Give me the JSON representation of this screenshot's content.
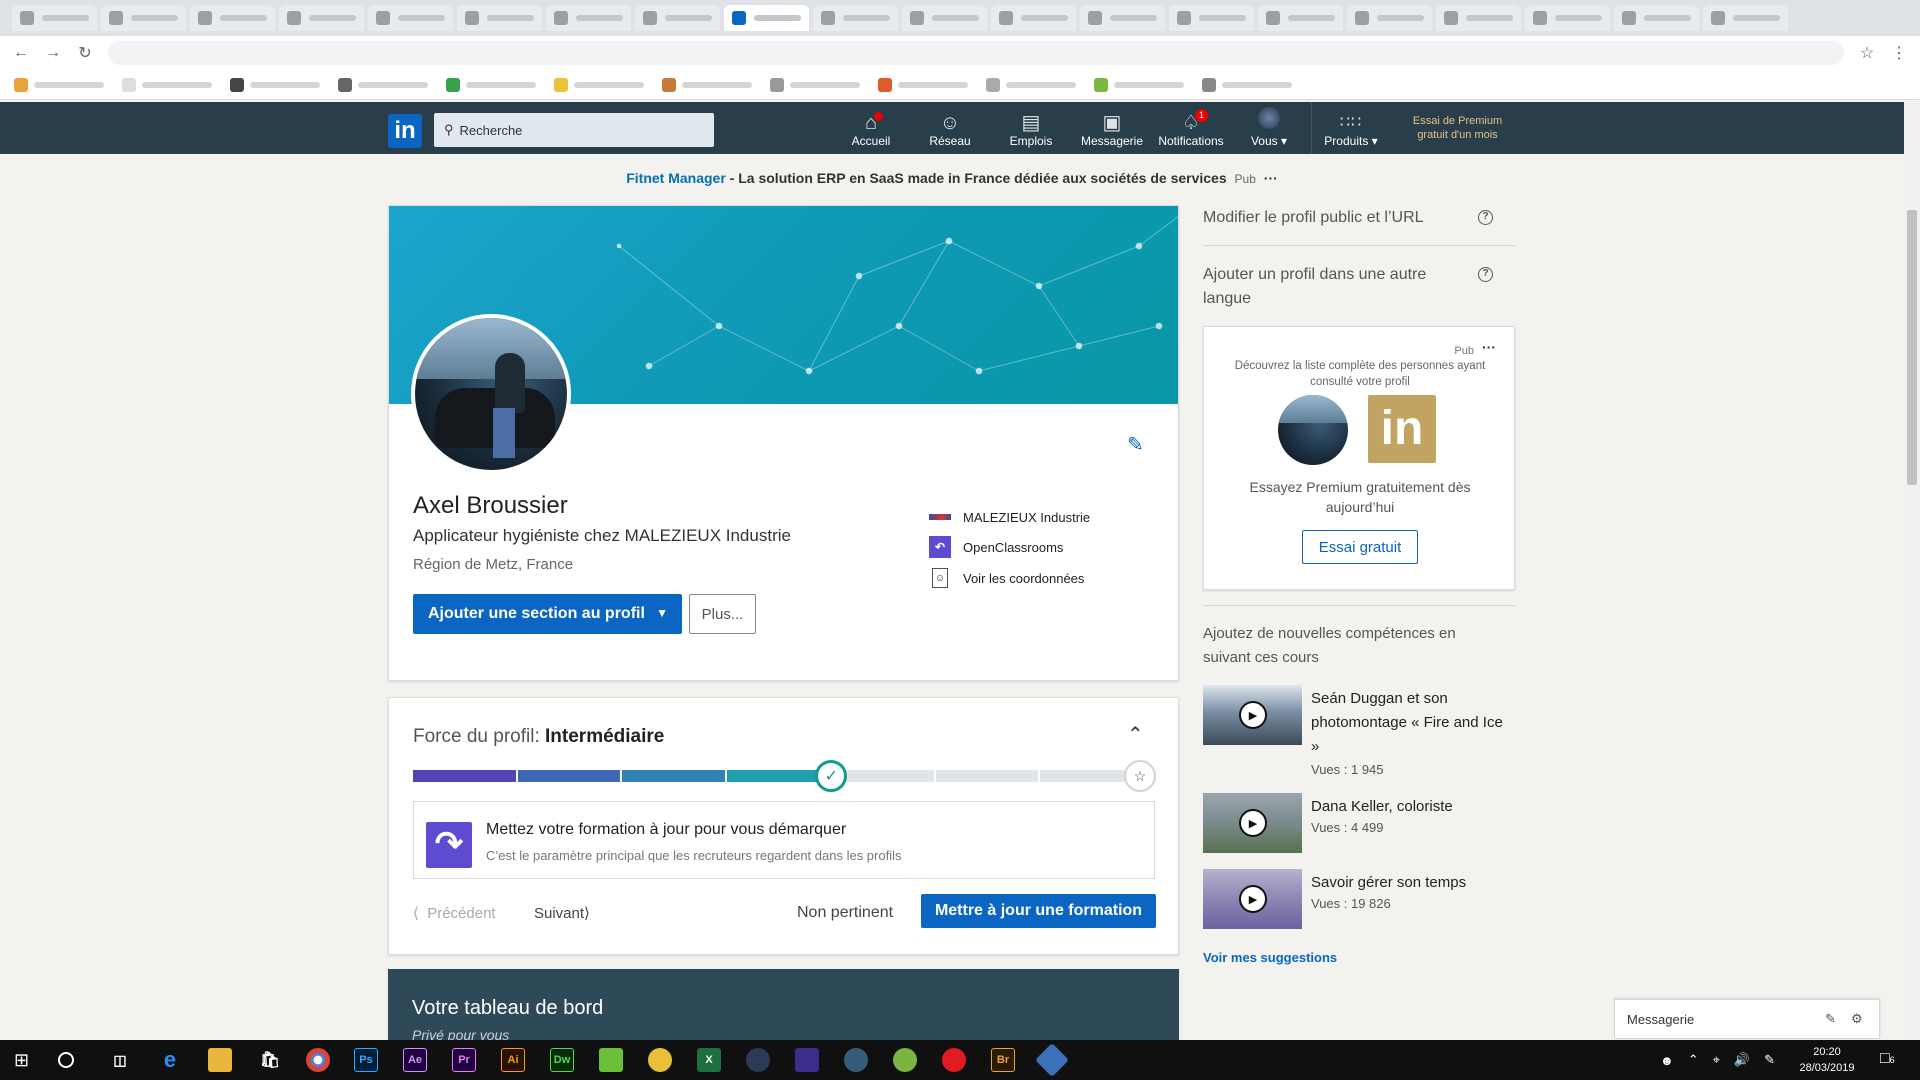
{
  "header": {
    "logo": "in",
    "search_placeholder": "Recherche",
    "nav": [
      {
        "label": "Accueil",
        "icon": "home-icon",
        "badge": ""
      },
      {
        "label": "Réseau",
        "icon": "network-icon",
        "badge": ""
      },
      {
        "label": "Emplois",
        "icon": "jobs-icon",
        "badge": ""
      },
      {
        "label": "Messagerie",
        "icon": "messaging-icon",
        "badge": ""
      },
      {
        "label": "Notifications",
        "icon": "bell-icon",
        "badge": "1"
      },
      {
        "label": "Vous",
        "icon": "avatar-icon",
        "badge": ""
      },
      {
        "label": "Produits",
        "icon": "grid-icon",
        "badge": ""
      }
    ],
    "premium_line1": "Essai de Premium",
    "premium_line2": "gratuit d'un mois"
  },
  "ad": {
    "brand": "Fitnet Manager",
    "text": " - La solution ERP en SaaS made in France dédiée aux sociétés de services",
    "pub": "Pub",
    "dots": "···"
  },
  "profile": {
    "name": "Axel Broussier",
    "headline": "Applicateur hygiéniste chez MALEZIEUX Industrie",
    "location": "Région de Metz, France",
    "add_section_label": "Ajouter une section au profil",
    "more_label": "Plus...",
    "company": "MALEZIEUX Industrie",
    "school": "OpenClassrooms",
    "contact": "Voir les coordonnées"
  },
  "strength": {
    "label": "Force du profil:",
    "level": "Intermédiaire",
    "level_fraction": 0.57,
    "tip_title": "Mettez votre formation à jour pour vous démarquer",
    "tip_sub": "C’est le paramètre principal que les recruteurs regardent dans les profils",
    "prev": "Précédent",
    "next": "Suivant",
    "ignore": "Non pertinent",
    "action": "Mettre à jour une formation"
  },
  "dashboard": {
    "title": "Votre tableau de bord",
    "subtitle": "Privé pour vous"
  },
  "sidebar": {
    "edit_public": "Modifier le profil public et l’URL",
    "add_language": "Ajouter un profil dans une autre langue",
    "premium_pub": "Pub",
    "premium_desc": "Découvrez la liste complète des personnes ayant consulté votre profil",
    "premium_try": "Essayez Premium gratuitement dès aujourd’hui",
    "premium_btn": "Essai gratuit",
    "courses_title": "Ajoutez de nouvelles compétences en suivant ces cours",
    "courses": [
      {
        "title": "Seán Duggan et son photomontage « Fire and Ice »",
        "views": "Vues : 1 945"
      },
      {
        "title": "Dana Keller, coloriste",
        "views": "Vues : 4 499"
      },
      {
        "title": "Savoir gérer son temps",
        "views": "Vues : 19 826"
      }
    ],
    "see_more": "Voir mes suggestions"
  },
  "messaging": {
    "label": "Messagerie"
  },
  "taskbar": {
    "time": "20:20",
    "date": "28/03/2019",
    "notif_count": "6"
  },
  "colors": {
    "brand_blue": "#0a66c2",
    "header_bg": "#283e4a",
    "meter_colors": [
      "#5046b6",
      "#3f66b5",
      "#2f82b1",
      "#1fa0ac",
      "#139a8e"
    ]
  }
}
